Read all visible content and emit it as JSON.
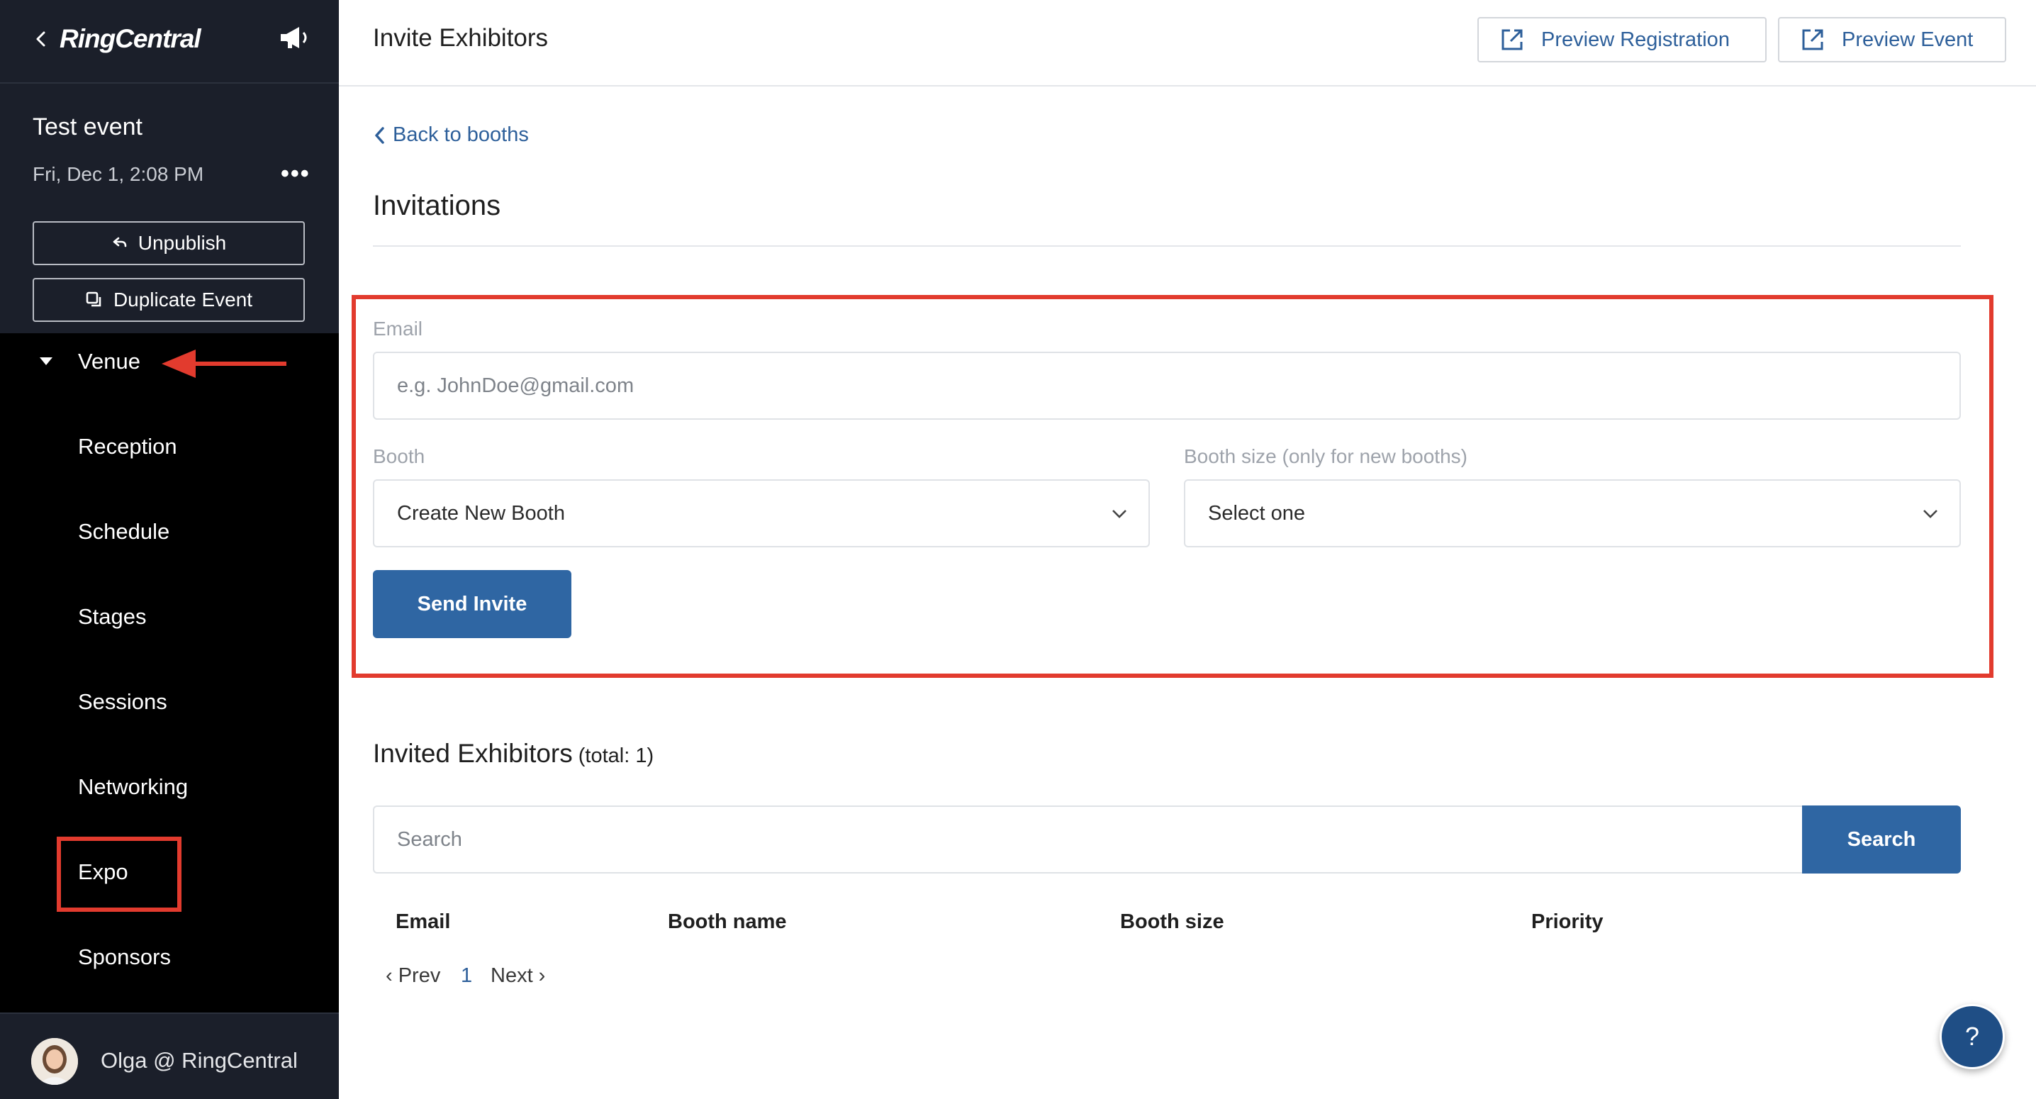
{
  "sidebar": {
    "logo": "RingCentral",
    "event": {
      "title": "Test event",
      "date": "Fri, Dec 1, 2:08 PM",
      "more": "•••",
      "unpublish_label": "Unpublish",
      "duplicate_label": "Duplicate Event"
    },
    "nav": {
      "venue_label": "Venue",
      "items": [
        "Reception",
        "Schedule",
        "Stages",
        "Sessions",
        "Networking",
        "Expo",
        "Sponsors"
      ]
    },
    "user": {
      "name": "Olga @ RingCentral"
    }
  },
  "header": {
    "title": "Invite Exhibitors",
    "preview_registration_label": "Preview Registration",
    "preview_event_label": "Preview Event"
  },
  "main": {
    "back_link": "Back to booths",
    "section_title": "Invitations",
    "form": {
      "email_label": "Email",
      "email_placeholder": "e.g. JohnDoe@gmail.com",
      "booth_label": "Booth",
      "booth_value": "Create New Booth",
      "booth_size_label": "Booth size (only for new booths)",
      "booth_size_value": "Select one",
      "send_label": "Send Invite"
    },
    "invited": {
      "title": "Invited Exhibitors",
      "total": "(total: 1)",
      "search_placeholder": "Search",
      "search_button": "Search",
      "columns": [
        "Email",
        "Booth name",
        "Booth size",
        "Priority"
      ],
      "pager": {
        "prev": "‹ Prev",
        "page": "1",
        "next": "Next ›"
      }
    },
    "help_label": "?"
  },
  "colors": {
    "accent": "#2f66a3",
    "link": "#2d5f9a",
    "highlight": "#e23b2e",
    "sidebar_bg": "#000000",
    "sidebar_panel": "#1b1f2a"
  }
}
